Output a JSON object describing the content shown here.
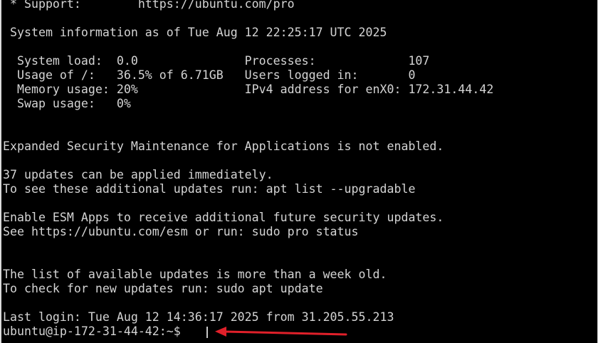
{
  "terminal": {
    "lines": [
      " * Support:        https://ubuntu.com/pro",
      "",
      " System information as of Tue Aug 12 22:25:17 UTC 2025",
      "",
      "  System load:  0.0               Processes:             107",
      "  Usage of /:   36.5% of 6.71GB   Users logged in:       0",
      "  Memory usage: 20%               IPv4 address for enX0: 172.31.44.42",
      "  Swap usage:   0%",
      "",
      "",
      "Expanded Security Maintenance for Applications is not enabled.",
      "",
      "37 updates can be applied immediately.",
      "To see these additional updates run: apt list --upgradable",
      "",
      "Enable ESM Apps to receive additional future security updates.",
      "See https://ubuntu.com/esm or run: sudo pro status",
      "",
      "",
      "The list of available updates is more than a week old.",
      "To check for new updates run: sudo apt update",
      "",
      "Last login: Tue Aug 12 14:36:17 2025 from 31.205.55.213",
      "ubuntu@ip-172-31-44-42:~$"
    ],
    "colors": {
      "background": "#000000",
      "text": "#d4d4d4",
      "annotation_arrow": "#e0202a"
    }
  }
}
